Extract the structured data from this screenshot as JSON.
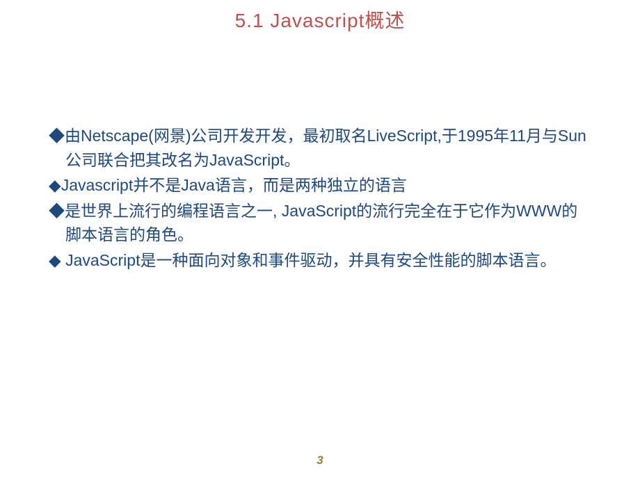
{
  "slide": {
    "title": "5.1 Javascript概述",
    "bullets": [
      {
        "marker": "◆",
        "text": "由Netscape(网景)公司开发开发，最初取名LiveScript,于1995年11月与Sun公司联合把其改名为JavaScript。"
      },
      {
        "marker": "◆",
        "text": "Javascript并不是Java语言，而是两种独立的语言"
      },
      {
        "marker": "◆",
        "text": "是世界上流行的编程语言之一, JavaScript的流行完全在于它作为WWW的脚本语言的角色。"
      },
      {
        "marker": "◆",
        "text": " JavaScript是一种面向对象和事件驱动，并具有安全性能的脚本语言。"
      }
    ],
    "page_number": "3"
  }
}
